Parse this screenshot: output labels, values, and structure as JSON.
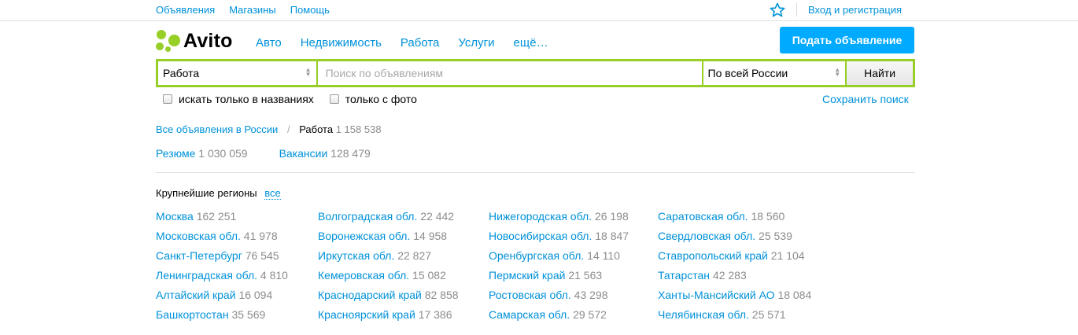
{
  "topbar": {
    "links": [
      "Объявления",
      "Магазины",
      "Помощь"
    ],
    "login": "Вход и регистрация"
  },
  "header": {
    "logo_text": "Avito",
    "nav": [
      "Авто",
      "Недвижимость",
      "Работа",
      "Услуги",
      "ещё…"
    ],
    "post_button": "Подать объявление"
  },
  "search": {
    "category": "Работа",
    "placeholder": "Поиск по объявлениям",
    "region": "По всей России",
    "find_button": "Найти",
    "opt_titles": "искать только в названиях",
    "opt_photo": "только с фото",
    "save": "Сохранить поиск"
  },
  "breadcrumb": {
    "root": "Все объявления в России",
    "sep": "/",
    "current": "Работа",
    "current_count": "1 158 538"
  },
  "subcats": [
    {
      "label": "Резюме",
      "count": "1 030 059"
    },
    {
      "label": "Вакансии",
      "count": "128 479"
    }
  ],
  "regions": {
    "title": "Крупнейшие регионы",
    "all": "все",
    "columns": [
      [
        {
          "name": "Москва",
          "count": "162 251"
        },
        {
          "name": "Московская обл.",
          "count": "41 978"
        },
        {
          "name": "Санкт-Петербург",
          "count": "76 545"
        },
        {
          "name": "Ленинградская обл.",
          "count": "4 810"
        },
        {
          "name": "Алтайский край",
          "count": "16 094"
        },
        {
          "name": "Башкортостан",
          "count": "35 569"
        }
      ],
      [
        {
          "name": "Волгоградская обл.",
          "count": "22 442"
        },
        {
          "name": "Воронежская обл.",
          "count": "14 958"
        },
        {
          "name": "Иркутская обл.",
          "count": "22 827"
        },
        {
          "name": "Кемеровская обл.",
          "count": "15 082"
        },
        {
          "name": "Краснодарский край",
          "count": "82 858"
        },
        {
          "name": "Красноярский край",
          "count": "17 386"
        }
      ],
      [
        {
          "name": "Нижегородская обл.",
          "count": "26 198"
        },
        {
          "name": "Новосибирская обл.",
          "count": "18 847"
        },
        {
          "name": "Оренбургская обл.",
          "count": "14 110"
        },
        {
          "name": "Пермский край",
          "count": "21 563"
        },
        {
          "name": "Ростовская обл.",
          "count": "43 298"
        },
        {
          "name": "Самарская обл.",
          "count": "29 572"
        }
      ],
      [
        {
          "name": "Саратовская обл.",
          "count": "18 560"
        },
        {
          "name": "Свердловская обл.",
          "count": "25 539"
        },
        {
          "name": "Ставропольский край",
          "count": "21 104"
        },
        {
          "name": "Татарстан",
          "count": "42 283"
        },
        {
          "name": "Ханты-Мансийский АО",
          "count": "18 084"
        },
        {
          "name": "Челябинская обл.",
          "count": "25 571"
        }
      ]
    ]
  },
  "colors": {
    "link": "#0091d9",
    "accent_green": "#97cf26",
    "button_blue": "#00aaff",
    "count_gray": "#8c8c8c"
  },
  "icons": {
    "favorites": "star-icon"
  }
}
